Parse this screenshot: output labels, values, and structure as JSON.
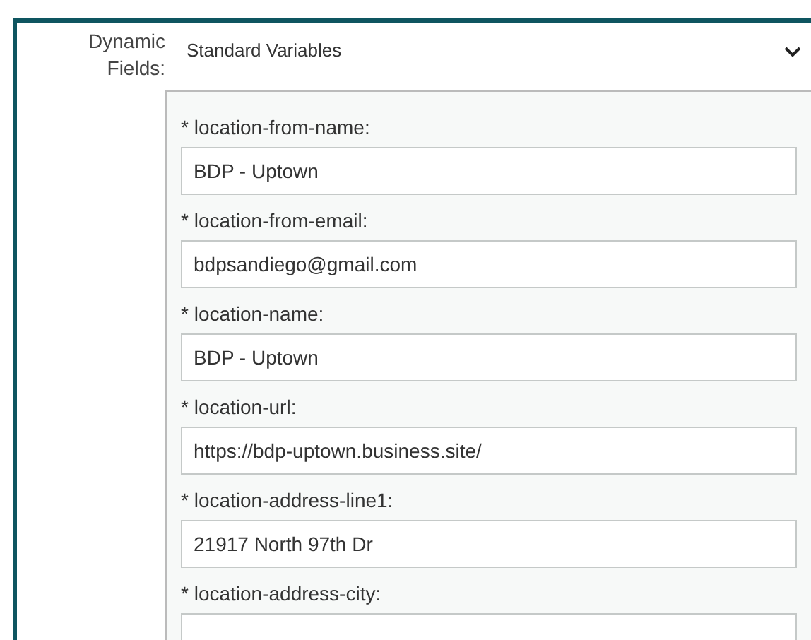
{
  "section_label": "Dynamic Fields:",
  "dropdown": {
    "value": "Standard Variables",
    "expanded": true
  },
  "fields": [
    {
      "label": "* location-from-name:",
      "value": "BDP - Uptown"
    },
    {
      "label": "* location-from-email:",
      "value": "bdpsandiego@gmail.com"
    },
    {
      "label": "* location-name:",
      "value": "BDP - Uptown"
    },
    {
      "label": "* location-url:",
      "value": "https://bdp-uptown.business.site/"
    },
    {
      "label": "* location-address-line1:",
      "value": "21917 North 97th Dr"
    },
    {
      "label": "* location-address-city:"
    }
  ]
}
